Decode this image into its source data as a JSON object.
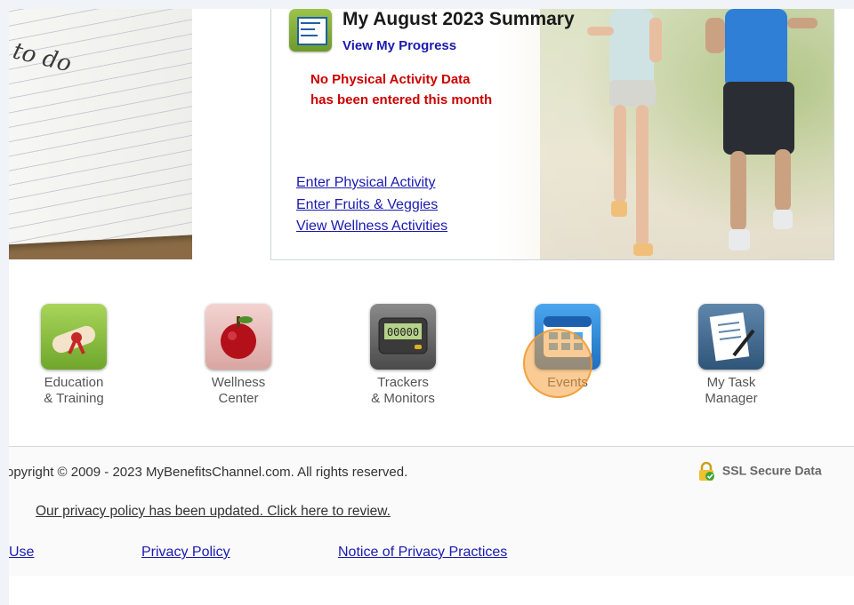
{
  "summary": {
    "title": "My August 2023 Summary",
    "progress_link": "View My Progress",
    "no_data_line1": "No Physical Activity Data",
    "no_data_line2": "has been entered this month",
    "actions": [
      "Enter Physical Activity",
      "Enter Fruits & Veggies",
      "View Wellness Activities"
    ]
  },
  "notebook": {
    "text": "to do"
  },
  "tiles": [
    {
      "line1": "Education",
      "line2": "& Training",
      "icon": "diploma-icon"
    },
    {
      "line1": "Wellness",
      "line2": "Center",
      "icon": "apple-icon"
    },
    {
      "line1": "Trackers",
      "line2": "& Monitors",
      "icon": "pedometer-icon"
    },
    {
      "line1": "Events",
      "line2": "",
      "icon": "calendar-icon"
    },
    {
      "line1": "My Task",
      "line2": "Manager",
      "icon": "task-list-icon"
    }
  ],
  "footer": {
    "copyright": "opyright © 2009 - 2023 MyBenefitsChannel.com. All rights reserved.",
    "ssl": "SSL Secure Data",
    "privacy_notice": "Our privacy policy has been updated. Click here to review.",
    "links": [
      "Use",
      "Privacy Policy",
      "Notice of Privacy Practices"
    ]
  },
  "colors": {
    "link": "#1a1ab0",
    "alert": "#cc0000",
    "accent": "#6ea72b"
  }
}
